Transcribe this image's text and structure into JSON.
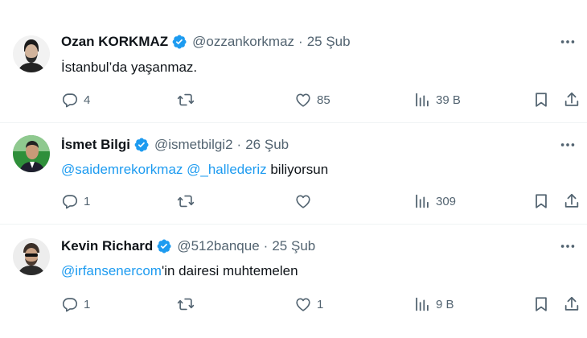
{
  "tweets": [
    {
      "name": "Ozan KORKMAZ",
      "handle": "@ozzankorkmaz",
      "separator": "·",
      "date": "25 Şub",
      "text": "İstanbul’da yaşanmaz.",
      "replies": "4",
      "retweets": "",
      "likes": "85",
      "views": "39 B"
    },
    {
      "name": "İsmet Bilgi",
      "handle": "@ismetbilgi2",
      "separator": "·",
      "date": "26 Şub",
      "mention1": "@saidemrekorkmaz",
      "mention2": "@_hallederiz",
      "text_rest": " biliyorsun",
      "replies": "1",
      "retweets": "",
      "likes": "",
      "views": "309"
    },
    {
      "name": "Kevin Richard",
      "handle": "@512banque",
      "separator": "·",
      "date": "25 Şub",
      "mention1": "@irfansenercom",
      "text_rest": "'in dairesi muhtemelen",
      "replies": "1",
      "retweets": "",
      "likes": "1",
      "views": "9 B"
    }
  ],
  "colors": {
    "text": "#0f1419",
    "secondary": "#536471",
    "accent": "#1d9bf0",
    "divider": "#eff3f4"
  },
  "icons": [
    "verified-badge-icon",
    "more-icon",
    "reply-icon",
    "retweet-icon",
    "like-icon",
    "views-icon",
    "bookmark-icon",
    "share-icon"
  ]
}
